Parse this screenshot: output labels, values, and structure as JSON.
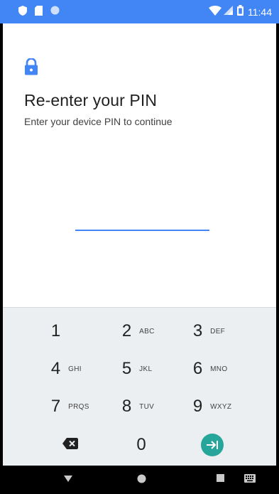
{
  "status_bar": {
    "time": "11:44",
    "icons_left": [
      "shield-icon",
      "sd-card-icon",
      "circle-icon"
    ],
    "icons_right": [
      "wifi-icon",
      "cell-signal-icon",
      "battery-icon"
    ]
  },
  "screen": {
    "title": "Re-enter your PIN",
    "subtitle": "Enter your device PIN to continue",
    "pin_value": "",
    "icon": "lock-icon",
    "accent_color": "#4285f4"
  },
  "keypad": {
    "keys": [
      {
        "num": "1",
        "letters": ""
      },
      {
        "num": "2",
        "letters": "ABC"
      },
      {
        "num": "3",
        "letters": "DEF"
      },
      {
        "num": "4",
        "letters": "GHI"
      },
      {
        "num": "5",
        "letters": "JKL"
      },
      {
        "num": "6",
        "letters": "MNO"
      },
      {
        "num": "7",
        "letters": "PRQS"
      },
      {
        "num": "8",
        "letters": "TUV"
      },
      {
        "num": "9",
        "letters": "WXYZ"
      },
      {
        "num": "0",
        "letters": ""
      }
    ],
    "backspace_icon": "backspace-icon",
    "enter_icon": "enter-arrow-icon",
    "enter_color": "#26a69a"
  },
  "nav_bar": {
    "buttons": [
      "back-icon",
      "home-icon",
      "recents-icon",
      "keyboard-icon"
    ]
  }
}
